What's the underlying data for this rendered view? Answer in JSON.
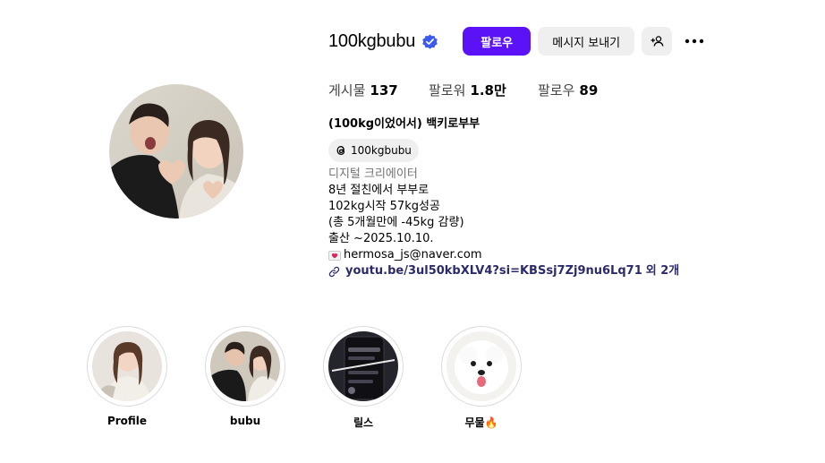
{
  "profile": {
    "username": "100kgbubu",
    "verified": true,
    "follow_label": "팔로우",
    "message_label": "메시지 보내기",
    "add_user_icon": "add-user-icon",
    "more_icon": "more-horizontal-icon"
  },
  "stats": {
    "posts_label": "게시물",
    "posts_value": "137",
    "followers_label": "팔로워",
    "followers_value": "1.8만",
    "following_label": "팔로우",
    "following_value": "89"
  },
  "bio": {
    "full_name": "(100kg이었어서) 백키로부부",
    "threads_handle": "100kgbubu",
    "category": "디지털 크리에이터",
    "lines": [
      "8년 절친에서 부부로",
      "102kg시작 57kg성공",
      "(총 5개월만에 -45kg 감량)",
      "출산 ~2025.10.10."
    ],
    "email": "hermosa_js@naver.com",
    "link_text": "youtu.be/3ul50kbXLV4?si=KBSsj7Zj9nu6Lq71",
    "link_extra": "외 2개"
  },
  "highlights": [
    {
      "label": "Profile"
    },
    {
      "label": "bubu"
    },
    {
      "label": "릴스"
    },
    {
      "label": "무물🔥"
    }
  ],
  "colors": {
    "follow_button": "#5b12f7",
    "secondary_button": "#efefef",
    "verified_badge": "#3b5bf0"
  }
}
